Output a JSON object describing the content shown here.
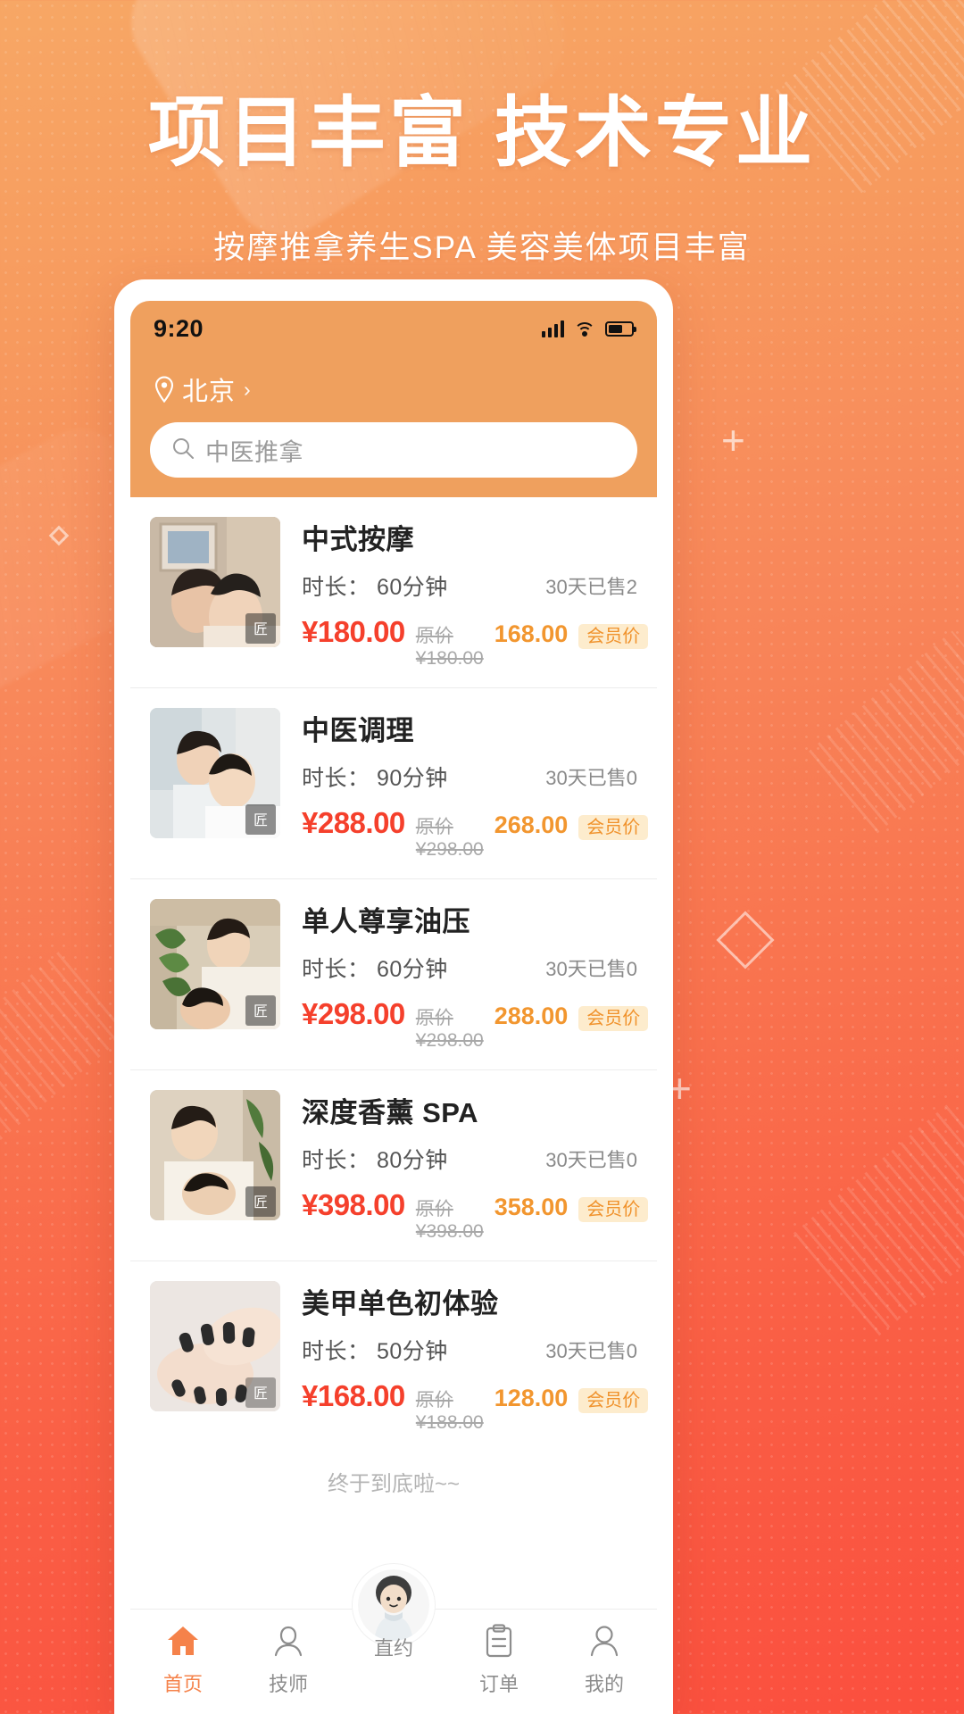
{
  "poster": {
    "title": "项目丰富 技术专业",
    "subtitle": "按摩推拿养生SPA 美容美体项目丰富"
  },
  "phone": {
    "status": {
      "time": "9:20",
      "signal_icon": "signal-bars-icon",
      "wifi_icon": "wifi-icon",
      "battery_icon": "battery-icon"
    },
    "header": {
      "location_icon": "location-pin-icon",
      "city": "北京",
      "city_arrow": "›",
      "search_icon": "search-icon",
      "search_placeholder": "中医推拿",
      "search_value": ""
    },
    "list": {
      "duration_label": "时长：",
      "sold_prefix": "30天已售",
      "currency": "¥",
      "orig_label": "原价 ¥",
      "member_badge": "会员价",
      "items": [
        {
          "title": "中式按摩",
          "duration": "60分钟",
          "sold": "2",
          "price": "¥180.00",
          "orig_price": "原价 ¥180.00",
          "member_price": "168.00",
          "badge": "会员价"
        },
        {
          "title": "中医调理",
          "duration": "90分钟",
          "sold": "0",
          "price": "¥288.00",
          "orig_price": "原价 ¥298.00",
          "member_price": "268.00",
          "badge": "会员价"
        },
        {
          "title": "单人尊享油压",
          "duration": "60分钟",
          "sold": "0",
          "price": "¥298.00",
          "orig_price": "原价 ¥298.00",
          "member_price": "288.00",
          "badge": "会员价"
        },
        {
          "title": "深度香薰 SPA",
          "duration": "80分钟",
          "sold": "0",
          "price": "¥398.00",
          "orig_price": "原价 ¥398.00",
          "member_price": "358.00",
          "badge": "会员价"
        },
        {
          "title": "美甲单色初体验",
          "duration": "50分钟",
          "sold": "0",
          "price": "¥168.00",
          "orig_price": "原价 ¥188.00",
          "member_price": "128.00",
          "badge": "会员价"
        }
      ],
      "end_text": "终于到底啦~~"
    },
    "tabbar": [
      {
        "label": "首页",
        "icon": "home-icon",
        "active": true
      },
      {
        "label": "技师",
        "icon": "therapist-icon",
        "active": false
      },
      {
        "label": "直约",
        "icon": "booking-icon",
        "active": false
      },
      {
        "label": "订单",
        "icon": "order-icon",
        "active": false
      },
      {
        "label": "我的",
        "icon": "profile-icon",
        "active": false
      }
    ]
  },
  "colors": {
    "bg_top": "#f7a765",
    "bg_bottom": "#fb4f3e",
    "header_orange": "#efa05e",
    "price_red": "#f5402c",
    "member_orange": "#f2962f",
    "badge_bg": "#fdeccd",
    "tab_active": "#f5824a"
  },
  "decor": {
    "plus_glyph": "+",
    "diamond_glyph": "◇"
  }
}
